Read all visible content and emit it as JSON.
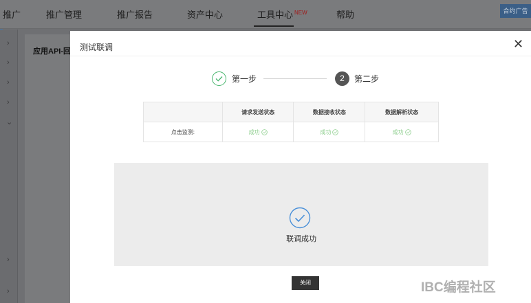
{
  "nav": {
    "items": [
      {
        "label": "推广"
      },
      {
        "label": "推广管理"
      },
      {
        "label": "推广报告"
      },
      {
        "label": "资产中心"
      },
      {
        "label": "工具中心",
        "badge": "NEW"
      },
      {
        "label": "帮助"
      }
    ],
    "promo_button": "合约广告"
  },
  "background": {
    "panel_title": "应用API-回"
  },
  "modal": {
    "title": "测试联调",
    "steps": [
      {
        "label": "第一步",
        "state": "done"
      },
      {
        "number": "2",
        "label": "第二步",
        "state": "current"
      }
    ],
    "table": {
      "headers": [
        "",
        "请求发送状态",
        "数据接收状态",
        "数据解析状态"
      ],
      "row": {
        "label": "点击监测:",
        "cells": [
          "成功",
          "成功",
          "成功"
        ]
      }
    },
    "result_text": "联调成功",
    "close_button": "关闭"
  },
  "watermark": "IBC编程社区",
  "colors": {
    "success_green": "#48b56d",
    "success_light": "#8fcf8f",
    "result_blue": "#4a90d9",
    "dark_button": "#333333"
  }
}
